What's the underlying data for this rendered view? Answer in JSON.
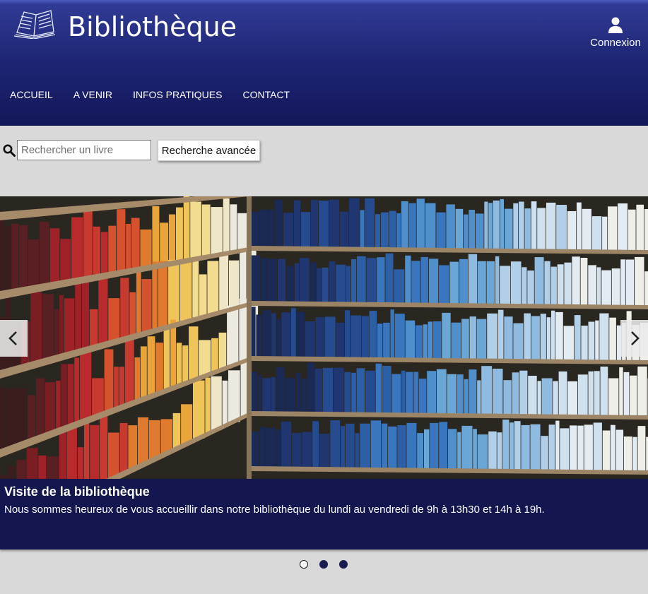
{
  "header": {
    "brand": "Bibliothèque",
    "login_label": "Connexion"
  },
  "nav": {
    "items": [
      {
        "label": "ACCUEIL"
      },
      {
        "label": "A VENIR"
      },
      {
        "label": "INFOS PRATIQUES"
      },
      {
        "label": "CONTACT"
      }
    ]
  },
  "search": {
    "placeholder": "Rechercher un livre",
    "value": "",
    "advanced_label": "Recherche avancée"
  },
  "carousel": {
    "slide_title": "Visite de la bibliothèque",
    "slide_text": "Nous sommes heureux de vous accueillir dans notre bibliothèque du lundi au vendredi de 9h à 13h30 et 14h à 19h.",
    "slide_count": 3,
    "active_index": 0
  },
  "icons": {
    "logo": "book-icon",
    "login": "user-icon",
    "search": "search-icon",
    "prev": "chevron-left-icon",
    "next": "chevron-right-icon"
  },
  "colors": {
    "header_top": "#4a5cc0",
    "header_bottom": "#13175a",
    "caption_bg": "#141650",
    "page_bg": "#d9d9d9"
  }
}
